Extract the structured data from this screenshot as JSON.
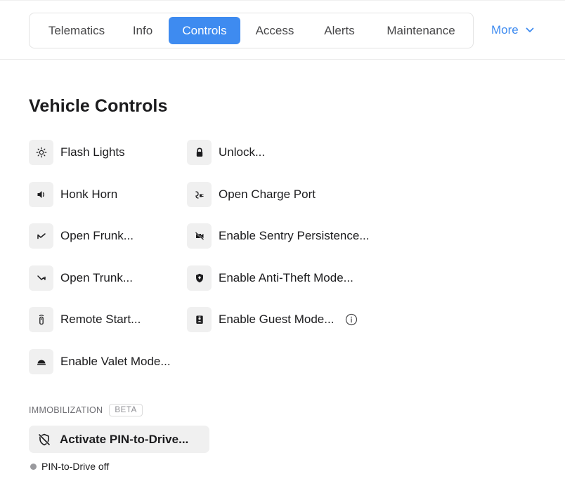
{
  "tabs": [
    {
      "label": "Telematics",
      "active": false
    },
    {
      "label": "Info",
      "active": false
    },
    {
      "label": "Controls",
      "active": true
    },
    {
      "label": "Access",
      "active": false
    },
    {
      "label": "Alerts",
      "active": false
    },
    {
      "label": "Maintenance",
      "active": false
    }
  ],
  "more_label": "More",
  "page_title": "Vehicle Controls",
  "controls": {
    "flash_lights": {
      "label": "Flash Lights",
      "icon": "sun-icon"
    },
    "honk_horn": {
      "label": "Honk Horn",
      "icon": "speaker-icon"
    },
    "open_frunk": {
      "label": "Open Frunk...",
      "icon": "frunk-icon"
    },
    "open_trunk": {
      "label": "Open Trunk...",
      "icon": "trunk-icon"
    },
    "remote_start": {
      "label": "Remote Start...",
      "icon": "key-fob-icon"
    },
    "valet_mode": {
      "label": "Enable Valet Mode...",
      "icon": "valet-icon"
    },
    "unlock": {
      "label": "Unlock...",
      "icon": "lock-icon"
    },
    "charge_port": {
      "label": "Open Charge Port",
      "icon": "charge-plug-icon"
    },
    "sentry": {
      "label": "Enable Sentry Persistence...",
      "icon": "camera-off-icon"
    },
    "anti_theft": {
      "label": "Enable Anti-Theft Mode...",
      "icon": "shield-icon"
    },
    "guest_mode": {
      "label": "Enable Guest Mode...",
      "icon": "badge-icon"
    }
  },
  "immobilization": {
    "section_label": "IMMOBILIZATION",
    "badge": "BETA",
    "button_label": "Activate PIN-to-Drive...",
    "status_text": "PIN-to-Drive off"
  },
  "colors": {
    "accent": "#3e8bf0",
    "icon_bg": "#f0f0f0",
    "status_dot": "#9a9a9e"
  }
}
